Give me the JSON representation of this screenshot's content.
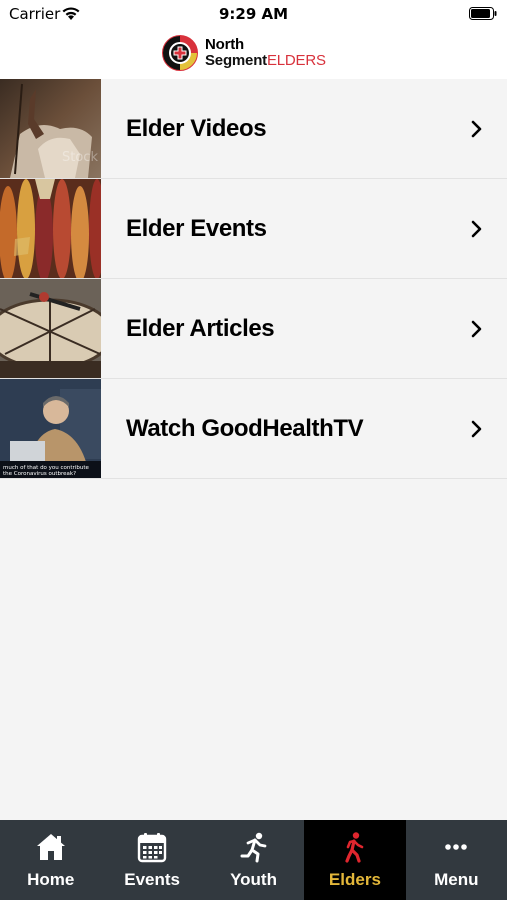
{
  "status_bar": {
    "carrier": "Carrier",
    "time": "9:29 AM"
  },
  "header": {
    "logo_line1": "North",
    "logo_line2_a": "Segment",
    "logo_line2_b": "ELDERS",
    "logo_accent": "#d8323c"
  },
  "list": {
    "items": [
      {
        "label": "Elder Videos",
        "icon": "chevron-right-icon"
      },
      {
        "label": "Elder Events",
        "icon": "chevron-right-icon"
      },
      {
        "label": "Elder Articles",
        "icon": "chevron-right-icon"
      },
      {
        "label": "Watch GoodHealthTV",
        "icon": "chevron-right-icon"
      }
    ]
  },
  "tab_bar": {
    "active_color": "#e3b73a",
    "tabs": [
      {
        "label": "Home",
        "icon": "home-icon"
      },
      {
        "label": "Events",
        "icon": "calendar-icon"
      },
      {
        "label": "Youth",
        "icon": "running-person-icon"
      },
      {
        "label": "Elders",
        "icon": "walking-person-icon",
        "active": true
      },
      {
        "label": "Menu",
        "icon": "more-icon"
      }
    ]
  }
}
